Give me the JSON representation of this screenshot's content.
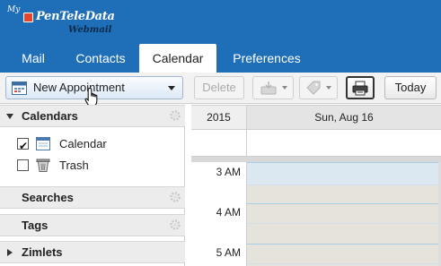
{
  "header": {
    "logo_prefix": "My",
    "logo_brand": "PenTeleData",
    "logo_suffix": "Webmail",
    "colors": {
      "bar": "#1f6fb8",
      "logo_mark": "#e8452f"
    }
  },
  "tabs": [
    {
      "label": "Mail",
      "active": false
    },
    {
      "label": "Contacts",
      "active": false
    },
    {
      "label": "Calendar",
      "active": true
    },
    {
      "label": "Preferences",
      "active": false
    }
  ],
  "toolbar": {
    "new_label": "New Appointment",
    "delete_label": "Delete",
    "today_label": "Today",
    "icons": [
      "calendar-icon",
      "move-icon",
      "tag-icon",
      "printer-icon"
    ]
  },
  "sidebar": {
    "calendars_header": "Calendars",
    "folders": [
      {
        "label": "Calendar",
        "checked": true,
        "icon": "calendar-folder-icon"
      },
      {
        "label": "Trash",
        "checked": false,
        "icon": "trash-icon"
      }
    ],
    "searches_header": "Searches",
    "tags_header": "Tags",
    "zimlets_header": "Zimlets"
  },
  "calendar": {
    "year": "2015",
    "day_label": "Sun, Aug 16",
    "hours": [
      "3 AM",
      "4 AM",
      "5 AM"
    ]
  }
}
